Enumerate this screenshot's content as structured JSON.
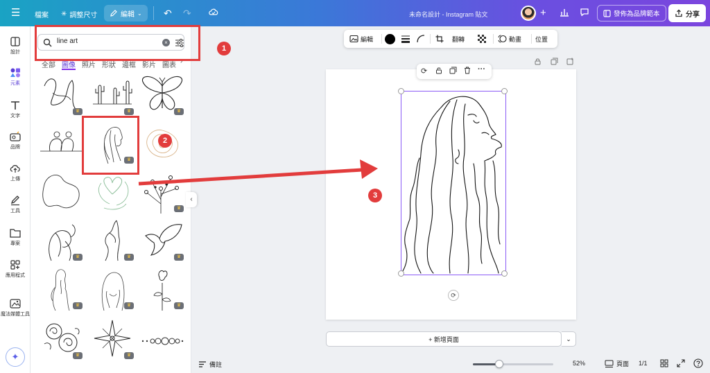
{
  "topbar": {
    "file": "檔案",
    "resize": "調整尺寸",
    "edit": "編輯",
    "doc_title": "未命名設計 - Instagram 貼文",
    "publish": "發佈為品牌範本",
    "share": "分享"
  },
  "rail": {
    "items": [
      {
        "label": "設計",
        "icon": "layout-icon"
      },
      {
        "label": "元素",
        "icon": "shapes-icon"
      },
      {
        "label": "文字",
        "icon": "text-icon"
      },
      {
        "label": "品牌",
        "icon": "brand-icon"
      },
      {
        "label": "上傳",
        "icon": "upload-icon"
      },
      {
        "label": "工具",
        "icon": "draw-icon"
      },
      {
        "label": "專案",
        "icon": "folder-icon"
      },
      {
        "label": "應用程式",
        "icon": "apps-icon"
      },
      {
        "label": "魔法媒體工具",
        "icon": "magic-media-icon"
      }
    ]
  },
  "panel": {
    "search": {
      "value": "line art",
      "placeholder": ""
    },
    "tabs": [
      "全部",
      "圖像",
      "照片",
      "形狀",
      "邊框",
      "影片",
      "圖表"
    ],
    "active_tab": "圖像"
  },
  "context_toolbar": {
    "edit": "編輯",
    "flip": "翻轉",
    "animate": "動畫",
    "position": "位置",
    "color": "#000000"
  },
  "canvas": {
    "add_page": "+ 新增頁面"
  },
  "bottombar": {
    "notes": "備註",
    "zoom": "52%",
    "pages_label": "頁面",
    "pages": "1/1",
    "zoom_value": 0.52
  },
  "annotations": {
    "b1": "1",
    "b2": "2",
    "b3": "3",
    "accent": "#e23c3c"
  }
}
